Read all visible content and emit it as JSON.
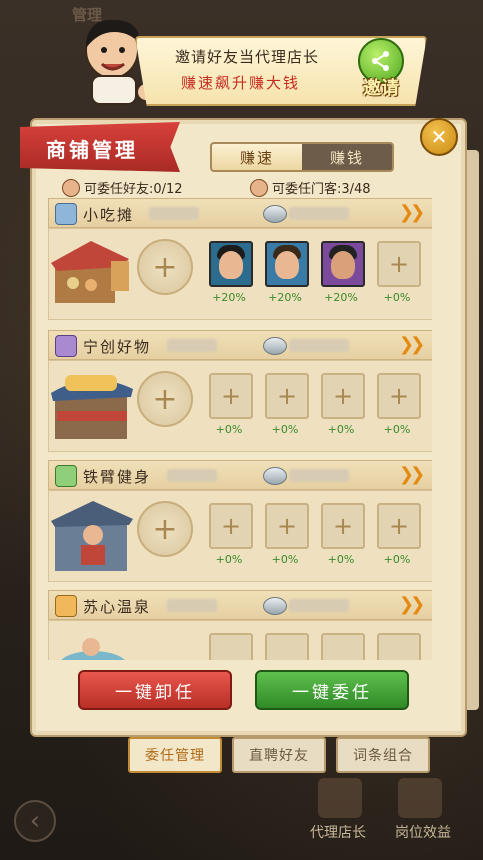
{
  "background": {
    "title": "管理"
  },
  "invite": {
    "line1": "邀请好友当代理店长",
    "line2": "赚速飙升赚大钱",
    "button": "邀请"
  },
  "panel": {
    "title": "商铺管理",
    "close": "✕",
    "toggle": {
      "left": "赚速",
      "right": "赚钱"
    },
    "friends_label": "可委任好友:0/12",
    "guests_label": "可委任门客:3/48"
  },
  "shops": [
    {
      "name": "小吃摊",
      "slots": [
        {
          "filled": true,
          "pct": "+20%"
        },
        {
          "filled": true,
          "pct": "+20%"
        },
        {
          "filled": true,
          "pct": "+20%"
        },
        {
          "filled": false,
          "pct": "+0%"
        }
      ]
    },
    {
      "name": "宁创好物",
      "slots": [
        {
          "filled": false,
          "pct": "+0%"
        },
        {
          "filled": false,
          "pct": "+0%"
        },
        {
          "filled": false,
          "pct": "+0%"
        },
        {
          "filled": false,
          "pct": "+0%"
        }
      ]
    },
    {
      "name": "铁臂健身",
      "slots": [
        {
          "filled": false,
          "pct": "+0%"
        },
        {
          "filled": false,
          "pct": "+0%"
        },
        {
          "filled": false,
          "pct": "+0%"
        },
        {
          "filled": false,
          "pct": "+0%"
        }
      ]
    },
    {
      "name": "苏心温泉",
      "slots": []
    }
  ],
  "buttons": {
    "unassign_all": "一键卸任",
    "assign_all": "一键委任"
  },
  "tabs": [
    "委任管理",
    "直聘好友",
    "词条组合"
  ],
  "bottom": {
    "left_label": "代理店长",
    "right_label": "岗位效益"
  },
  "symbols": {
    "plus": "+",
    "arrows": "❯❯",
    "back": "‹"
  }
}
